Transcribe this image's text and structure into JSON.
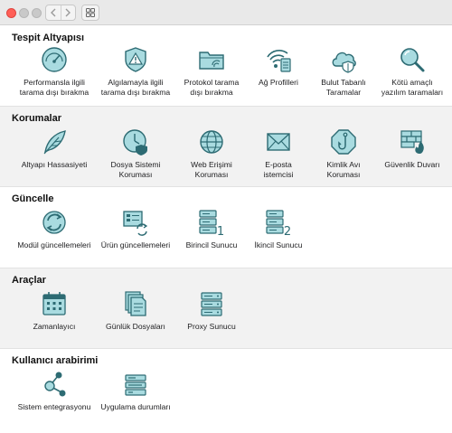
{
  "colors": {
    "icon_fill": "#a9dbe0",
    "icon_stroke": "#2d6b73",
    "alt_bg": "#f2f2f2"
  },
  "titlebar": {
    "back_icon": "chevron-left-icon",
    "forward_icon": "chevron-right-icon",
    "view_icon": "grid-view-icon"
  },
  "sections": [
    {
      "title": "Tespit Altyapısı",
      "items": [
        {
          "label": "Performansla ilgili\ntarama dışı bırakma",
          "icon": "gauge-icon"
        },
        {
          "label": "Algılamayla ilgili\ntarama dışı bırakma",
          "icon": "warning-shield-icon"
        },
        {
          "label": "Protokol tarama\ndışı bırakma",
          "icon": "folder-icon"
        },
        {
          "label": "Ağ Profilleri",
          "icon": "wifi-profile-icon"
        },
        {
          "label": "Bulut Tabanlı\nTaramalar",
          "icon": "cloud-shield-icon"
        },
        {
          "label": "Kötü amaçlı\nyazılım taramaları",
          "icon": "magnifier-icon"
        }
      ]
    },
    {
      "title": "Korumalar",
      "items": [
        {
          "label": "Altyapı Hassasiyeti",
          "icon": "feather-icon"
        },
        {
          "label": "Dosya Sistemi\nKoruması",
          "icon": "clock-shield-icon"
        },
        {
          "label": "Web Erişimi\nKoruması",
          "icon": "globe-icon"
        },
        {
          "label": "E-posta\nistemcisi",
          "icon": "envelope-icon"
        },
        {
          "label": "Kimlik Avı\nKoruması",
          "icon": "fishhook-icon"
        },
        {
          "label": "Güvenlik Duvarı",
          "icon": "firewall-icon"
        }
      ]
    },
    {
      "title": "Güncelle",
      "items": [
        {
          "label": "Modül güncellemeleri",
          "icon": "refresh-icon"
        },
        {
          "label": "Ürün güncellemeleri",
          "icon": "product-update-icon"
        },
        {
          "label": "Birincil Sunucu",
          "icon": "server-1-icon",
          "badge": "1"
        },
        {
          "label": "İkincil Sunucu",
          "icon": "server-2-icon",
          "badge": "2"
        }
      ]
    },
    {
      "title": "Araçlar",
      "items": [
        {
          "label": "Zamanlayıcı",
          "icon": "calendar-icon"
        },
        {
          "label": "Günlük Dosyaları",
          "icon": "log-files-icon"
        },
        {
          "label": "Proxy Sunucu",
          "icon": "proxy-server-icon"
        }
      ]
    },
    {
      "title": "Kullanıcı arabirimi",
      "items": [
        {
          "label": "Sistem entegrasyonu",
          "icon": "network-nodes-icon"
        },
        {
          "label": "Uygulama durumları",
          "icon": "app-status-icon"
        }
      ]
    }
  ]
}
